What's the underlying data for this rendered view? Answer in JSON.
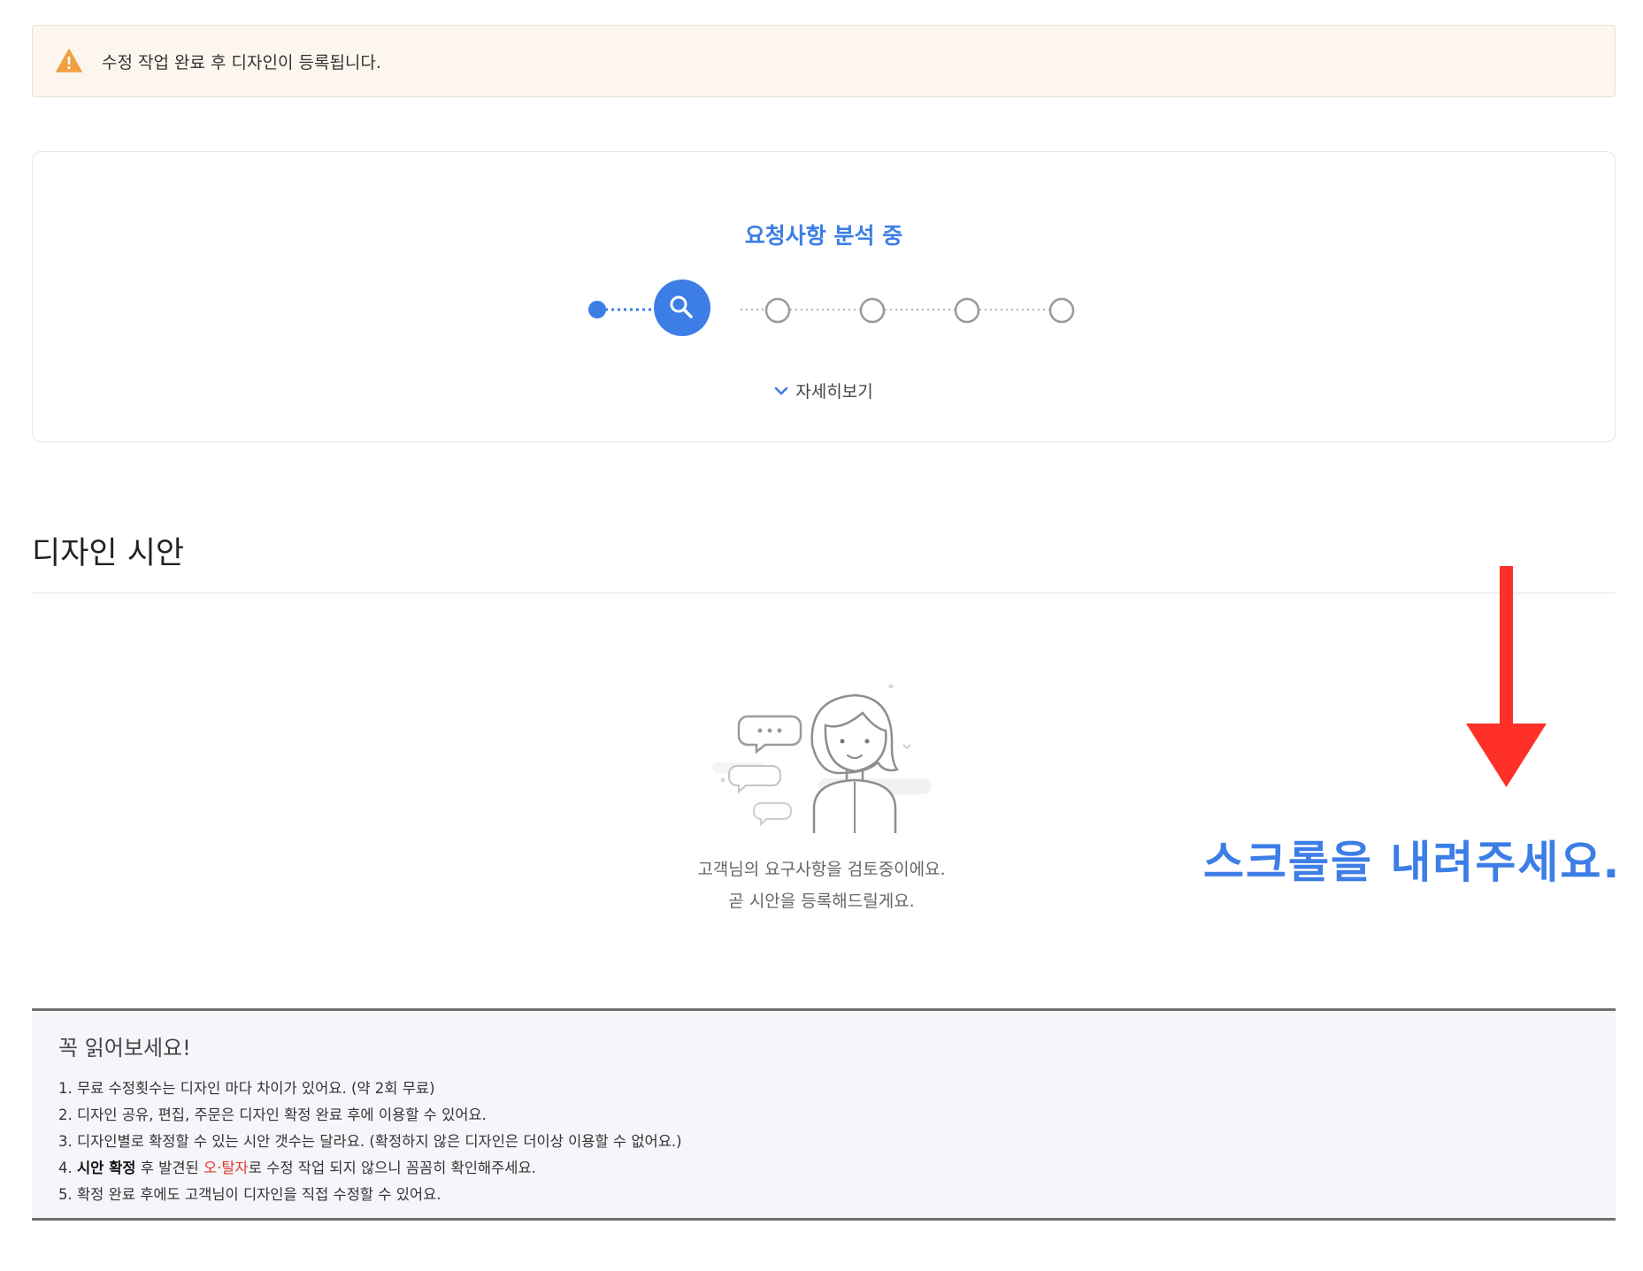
{
  "notice": {
    "icon": "warning-icon",
    "color": "#f0a040",
    "text": "수정 작업 완료 후 디자인이 등록됩니다."
  },
  "progress": {
    "title": "요청사항 분석 중",
    "accent": "#3d7ee6",
    "current_step_icon": "search-icon",
    "steps_total": 6,
    "current_step": 2,
    "details_label": "자세히보기"
  },
  "section": {
    "title": "디자인 시안"
  },
  "empty_state": {
    "illustration": "person-with-chat-bubbles",
    "line1": "고객님의 요구사항을 검토중이에요.",
    "line2": "곧 시안을 등록해드릴게요."
  },
  "annotation": {
    "arrow_color": "#ff3028",
    "text": "스크롤을 내려주세요."
  },
  "readme": {
    "title": "꼭 읽어보세요!",
    "items": [
      "1. 무료 수정횟수는 디자인 마다 차이가 있어요. (약 2회 무료)",
      "2. 디자인 공유, 편집, 주문은 디자인 확정 완료 후에 이용할 수 있어요.",
      "3. 디자인별로 확정할 수 있는 시안 갯수는 달라요. (확정하지 않은 디자인은 더이상 이용할 수 없어요.)"
    ],
    "item4": {
      "prefix": "4. ",
      "bold": "시안 확정",
      "mid": " 후 발견된 ",
      "red": "오·탈자",
      "suffix": "로 수정 작업 되지 않으니 꼼꼼히 확인해주세요."
    },
    "item5": "5. 확정 완료 후에도 고객님이 디자인을 직접 수정할 수 있어요."
  }
}
